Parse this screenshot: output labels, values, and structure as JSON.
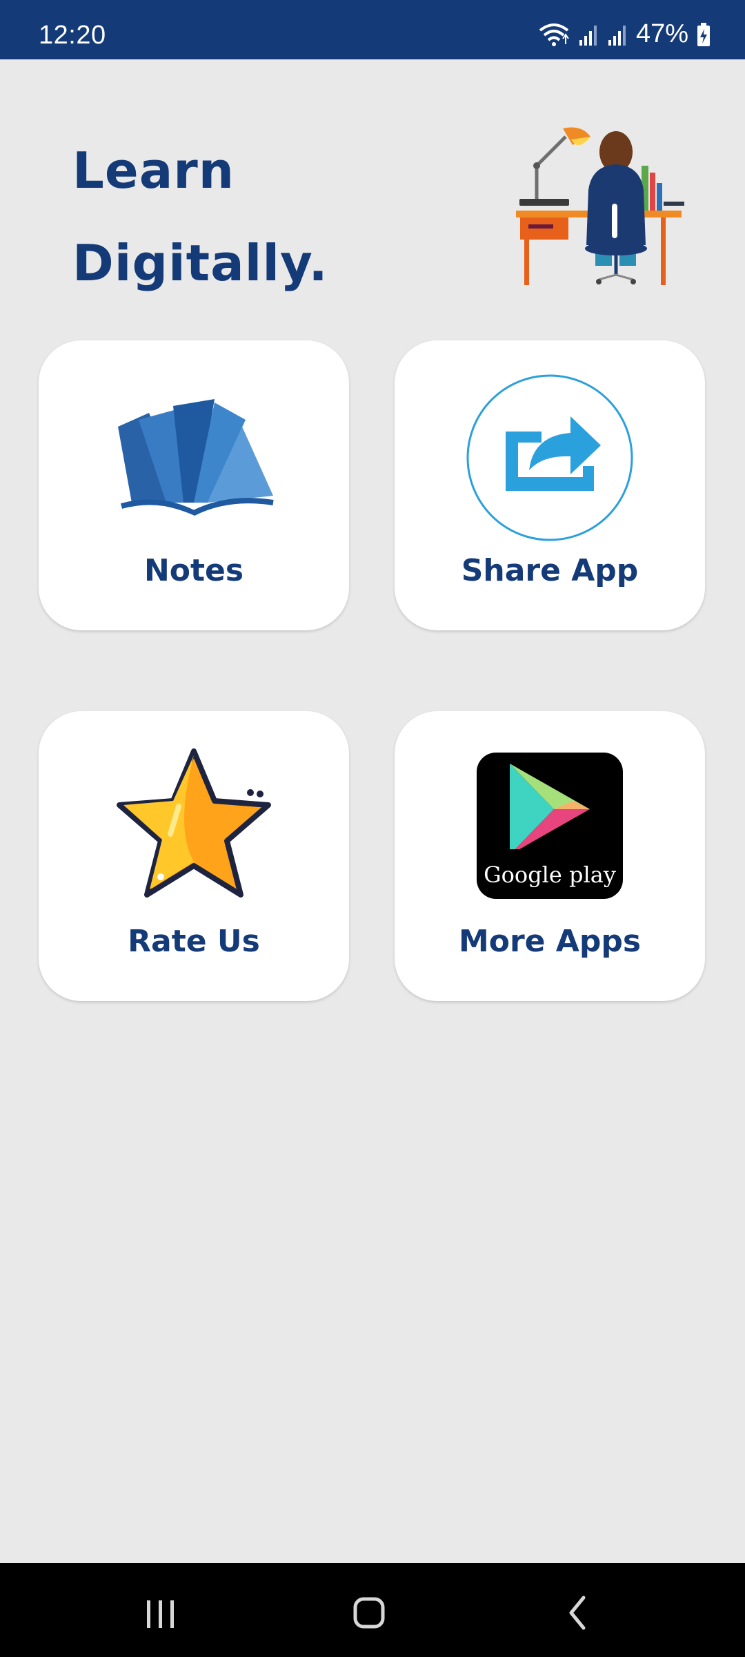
{
  "status_bar": {
    "time": "12:20",
    "battery_percent": "47%"
  },
  "hero": {
    "title_line1": "Learn",
    "title_line2": "Digitally."
  },
  "menu": {
    "notes": {
      "label": "Notes",
      "icon": "open-book-icon"
    },
    "share_app": {
      "label": "Share App",
      "icon": "share-icon"
    },
    "rate_us": {
      "label": "Rate Us",
      "icon": "star-icon"
    },
    "more_apps": {
      "label": "More Apps",
      "icon": "google-play-icon",
      "badge_text": "Google play"
    }
  },
  "colors": {
    "primary": "#143a78",
    "background": "#e9e9e9",
    "card": "#ffffff",
    "share_blue": "#2aa0dc"
  }
}
